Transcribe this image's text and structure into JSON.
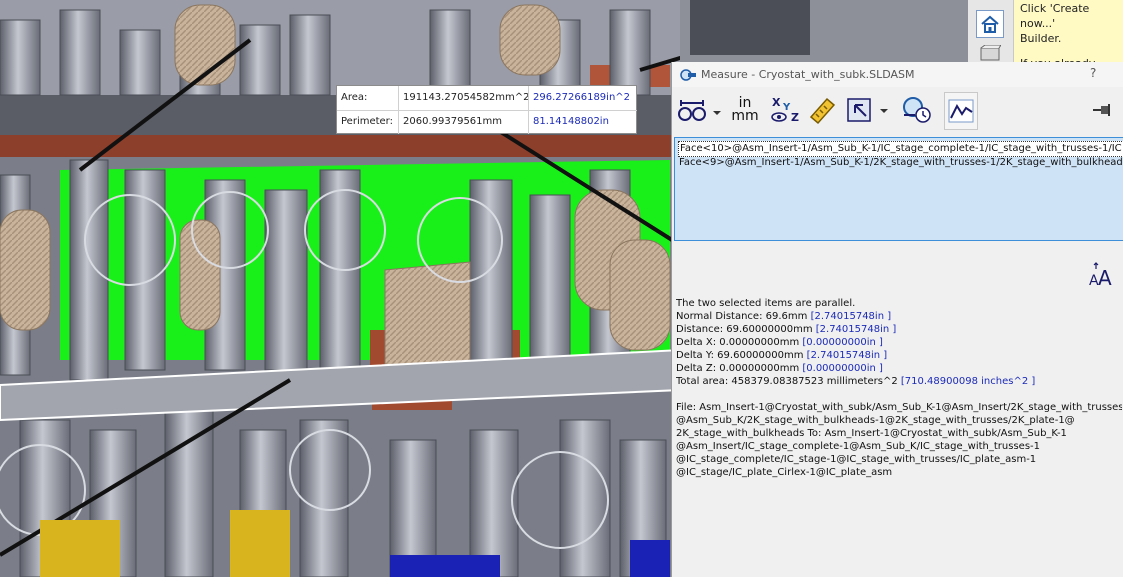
{
  "tooltip": {
    "area_label": "Area:",
    "area_mm": "191143.27054582mm^2",
    "area_in": "296.27266189in^2",
    "perimeter_label": "Perimeter:",
    "perimeter_mm": "2060.99379561mm",
    "perimeter_in": "81.14148802in"
  },
  "taskpane": {
    "message_line1": "Click 'Create now...'",
    "message_line2": "Builder.",
    "message_line3": "If you already have"
  },
  "measure": {
    "title": "Measure - Cryostat_with_subk.SLDASM",
    "help": "?",
    "units_top": "in",
    "units_bottom": "mm",
    "selections": [
      "Face<10>@Asm_Insert-1/Asm_Sub_K-1/IC_stage_complete-1/IC_stage_with_trusses-1/IC",
      "Face<9>@Asm_Insert-1/Asm_Sub_K-1/2K_stage_with_trusses-1/2K_stage_with_bulkhead"
    ],
    "results": {
      "parallel": "The two selected items are parallel.",
      "normal_label": "Normal Distance: 69.6mm",
      "normal_in": "[2.74015748in ]",
      "distance_label": "Distance: 69.60000000mm",
      "distance_in": "[2.74015748in ]",
      "dx_label": "Delta X: 0.00000000mm",
      "dx_in": "[0.00000000in ]",
      "dy_label": "Delta Y: 69.60000000mm",
      "dy_in": "[2.74015748in ]",
      "dz_label": "Delta Z: 0.00000000mm",
      "dz_in": "[0.00000000in ]",
      "total_label": "Total area: 458379.08387523 millimeters^2",
      "total_in": "[710.48900098 inches^2 ]",
      "file_lines": [
        "File: Asm_Insert-1@Cryostat_with_subk/Asm_Sub_K-1@Asm_Insert/2K_stage_with_trusses",
        "@Asm_Sub_K/2K_stage_with_bulkheads-1@2K_stage_with_trusses/2K_plate-1@",
        "2K_stage_with_bulkheads To: Asm_Insert-1@Cryostat_with_subk/Asm_Sub_K-1",
        "@Asm_Insert/IC_stage_complete-1@Asm_Sub_K/IC_stage_with_trusses-1",
        "@IC_stage_complete/IC_stage-1@IC_stage_with_trusses/IC_plate_asm-1",
        "@IC_stage/IC_plate_Cirlex-1@IC_plate_asm"
      ]
    }
  },
  "colors": {
    "highlight_green": "#19f01a",
    "model_gray": "#8f93a0",
    "copper": "#a24a30",
    "insulation": "#c9b39b",
    "link_blue": "#1c2bb8"
  }
}
